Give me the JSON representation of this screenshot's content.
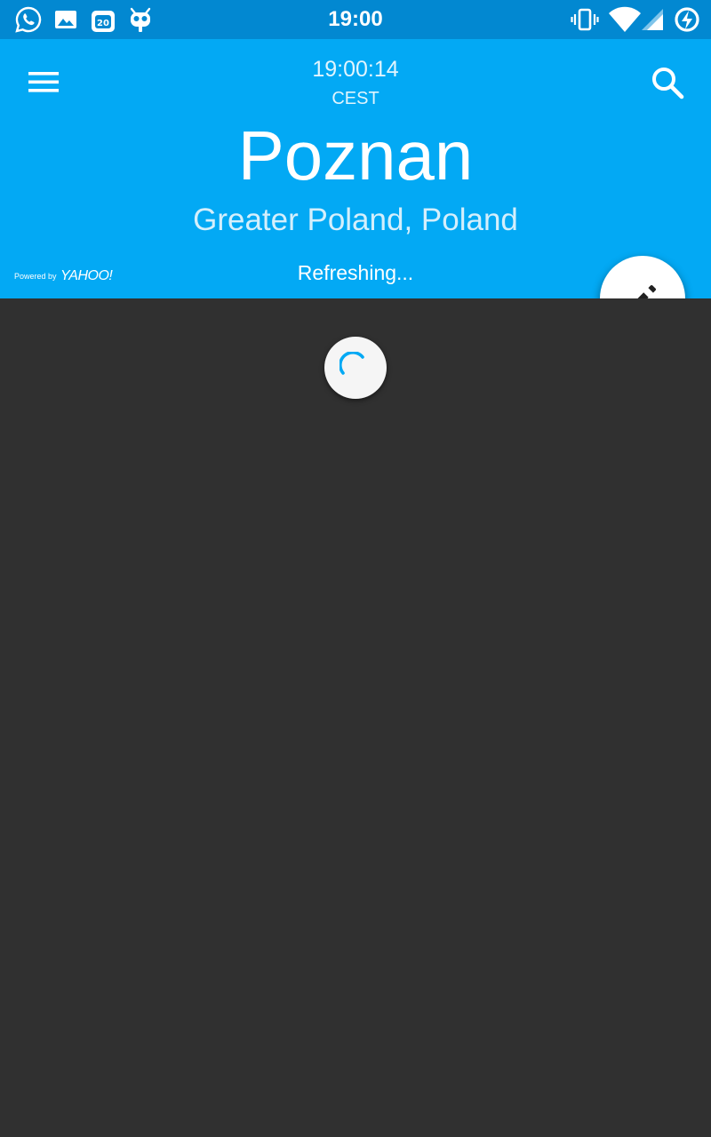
{
  "status_bar": {
    "time": "19:00",
    "calendar_badge": "20",
    "left_icons": [
      "whatsapp-icon",
      "gallery-icon",
      "calendar-icon",
      "cyanogen-icon"
    ],
    "right_icons": [
      "vibrate-icon",
      "wifi-icon",
      "signal-icon",
      "battery-charging-icon"
    ],
    "color": "#0288D1"
  },
  "header": {
    "local_time": "19:00:14",
    "timezone": "CEST",
    "city": "Poznan",
    "region": "Greater Poland, Poland",
    "status": "Refreshing...",
    "powered_by_prefix": "Powered by",
    "powered_by_brand": "YAHOO!",
    "menu_icon": "menu-icon",
    "search_icon": "search-icon",
    "color": "#03A9F4"
  },
  "fab": {
    "icon": "pencil-icon"
  },
  "content": {
    "background": "#303030",
    "spinner_icon": "loading-spinner-icon"
  }
}
